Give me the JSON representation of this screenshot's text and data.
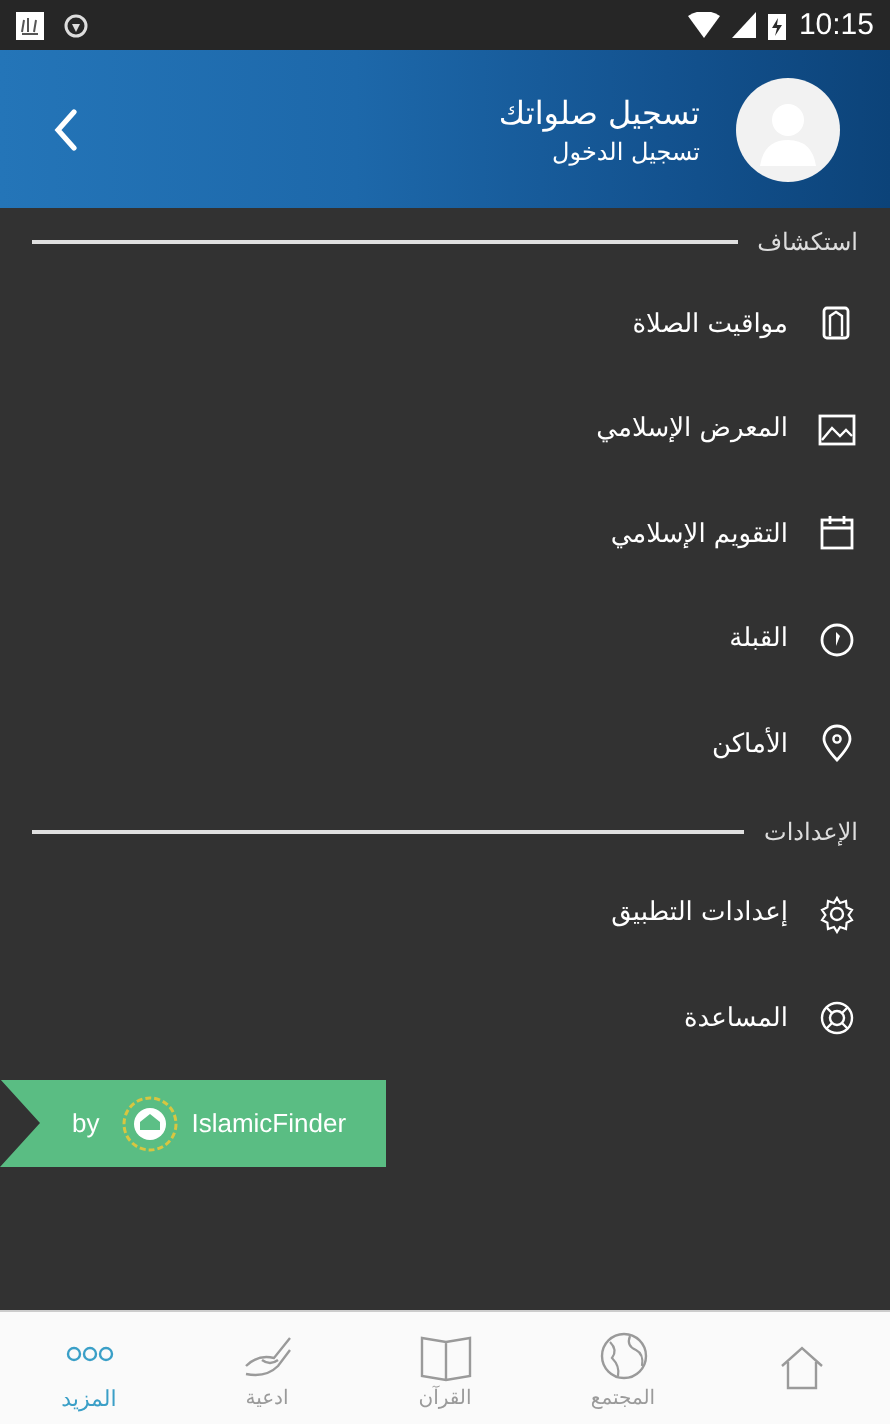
{
  "status_bar": {
    "time": "10:15"
  },
  "header": {
    "title": "تسجيل صلواتك",
    "subtitle": "تسجيل الدخول"
  },
  "sections": [
    {
      "title": "استكشاف",
      "items": [
        {
          "label": "مواقيت الصلاة"
        },
        {
          "label": "المعرض الإسلامي"
        },
        {
          "label": "التقويم الإسلامي"
        },
        {
          "label": "القبلة"
        },
        {
          "label": "الأماكن"
        }
      ]
    },
    {
      "title": "الإعدادات",
      "items": [
        {
          "label": "إعدادات التطبيق"
        },
        {
          "label": "المساعدة"
        }
      ]
    }
  ],
  "brand": {
    "prefix": "by",
    "name": "IslamicFinder"
  },
  "bottom_nav": [
    {
      "selected": false
    },
    {
      "label": "المجتمع",
      "selected": false
    },
    {
      "label": "القرآن",
      "selected": false
    },
    {
      "label": "ادعية",
      "selected": false
    },
    {
      "label": "المزيد",
      "selected": true
    }
  ]
}
